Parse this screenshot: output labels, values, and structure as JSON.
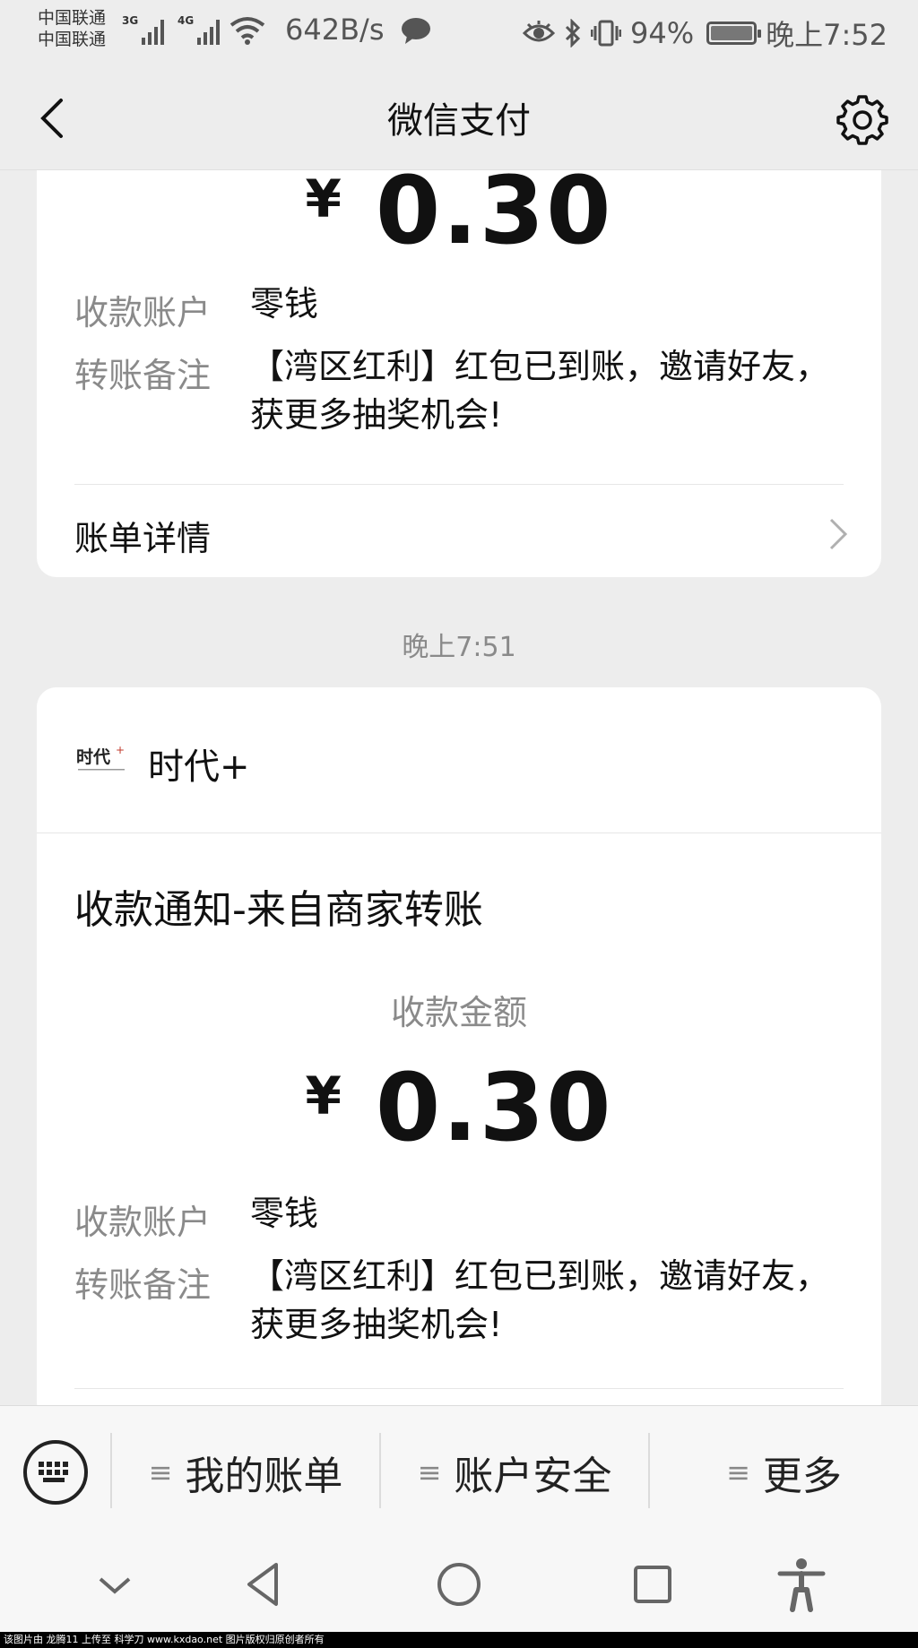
{
  "status_bar": {
    "carrier_1": "中国联通",
    "carrier_2": "中国联通",
    "signal_1_gen": "3G",
    "signal_2_gen": "4G",
    "net_speed": "642B/s",
    "battery": "94%",
    "time": "晚上7:52"
  },
  "nav": {
    "title": "微信支付",
    "back_icon": "chevron-left-icon",
    "settings_icon": "gear-icon"
  },
  "card_top": {
    "currency": "¥",
    "amount": "0.30",
    "account_label": "收款账户",
    "account_value": "零钱",
    "note_label": "转账备注",
    "note_value": "【湾区红利】红包已到账，邀请好友，获更多抽奖机会!",
    "bill_detail": "账单详情"
  },
  "timestamp": "晚上7:51",
  "card_main": {
    "merchant_logo_text": "时代",
    "merchant_name": "时代+",
    "notice_title": "收款通知-来自商家转账",
    "amount_label": "收款金额",
    "currency": "¥",
    "amount": "0.30",
    "account_label": "收款账户",
    "account_value": "零钱",
    "note_label": "转账备注",
    "note_value": "【湾区红利】红包已到账，邀请好友，获更多抽奖机会!"
  },
  "menu": {
    "keyboard_icon": "keyboard-icon",
    "items": [
      "我的账单",
      "账户安全",
      "更多"
    ],
    "lines_glyph": "≡"
  },
  "system_nav": {
    "icons": [
      "chevron-down-icon",
      "back-triangle-icon",
      "home-circle-icon",
      "recents-square-icon",
      "accessibility-icon"
    ]
  },
  "watermark": "该图片由 龙腾11 上传至 科学刀 www.kxdao.net 图片版权归原创者所有"
}
